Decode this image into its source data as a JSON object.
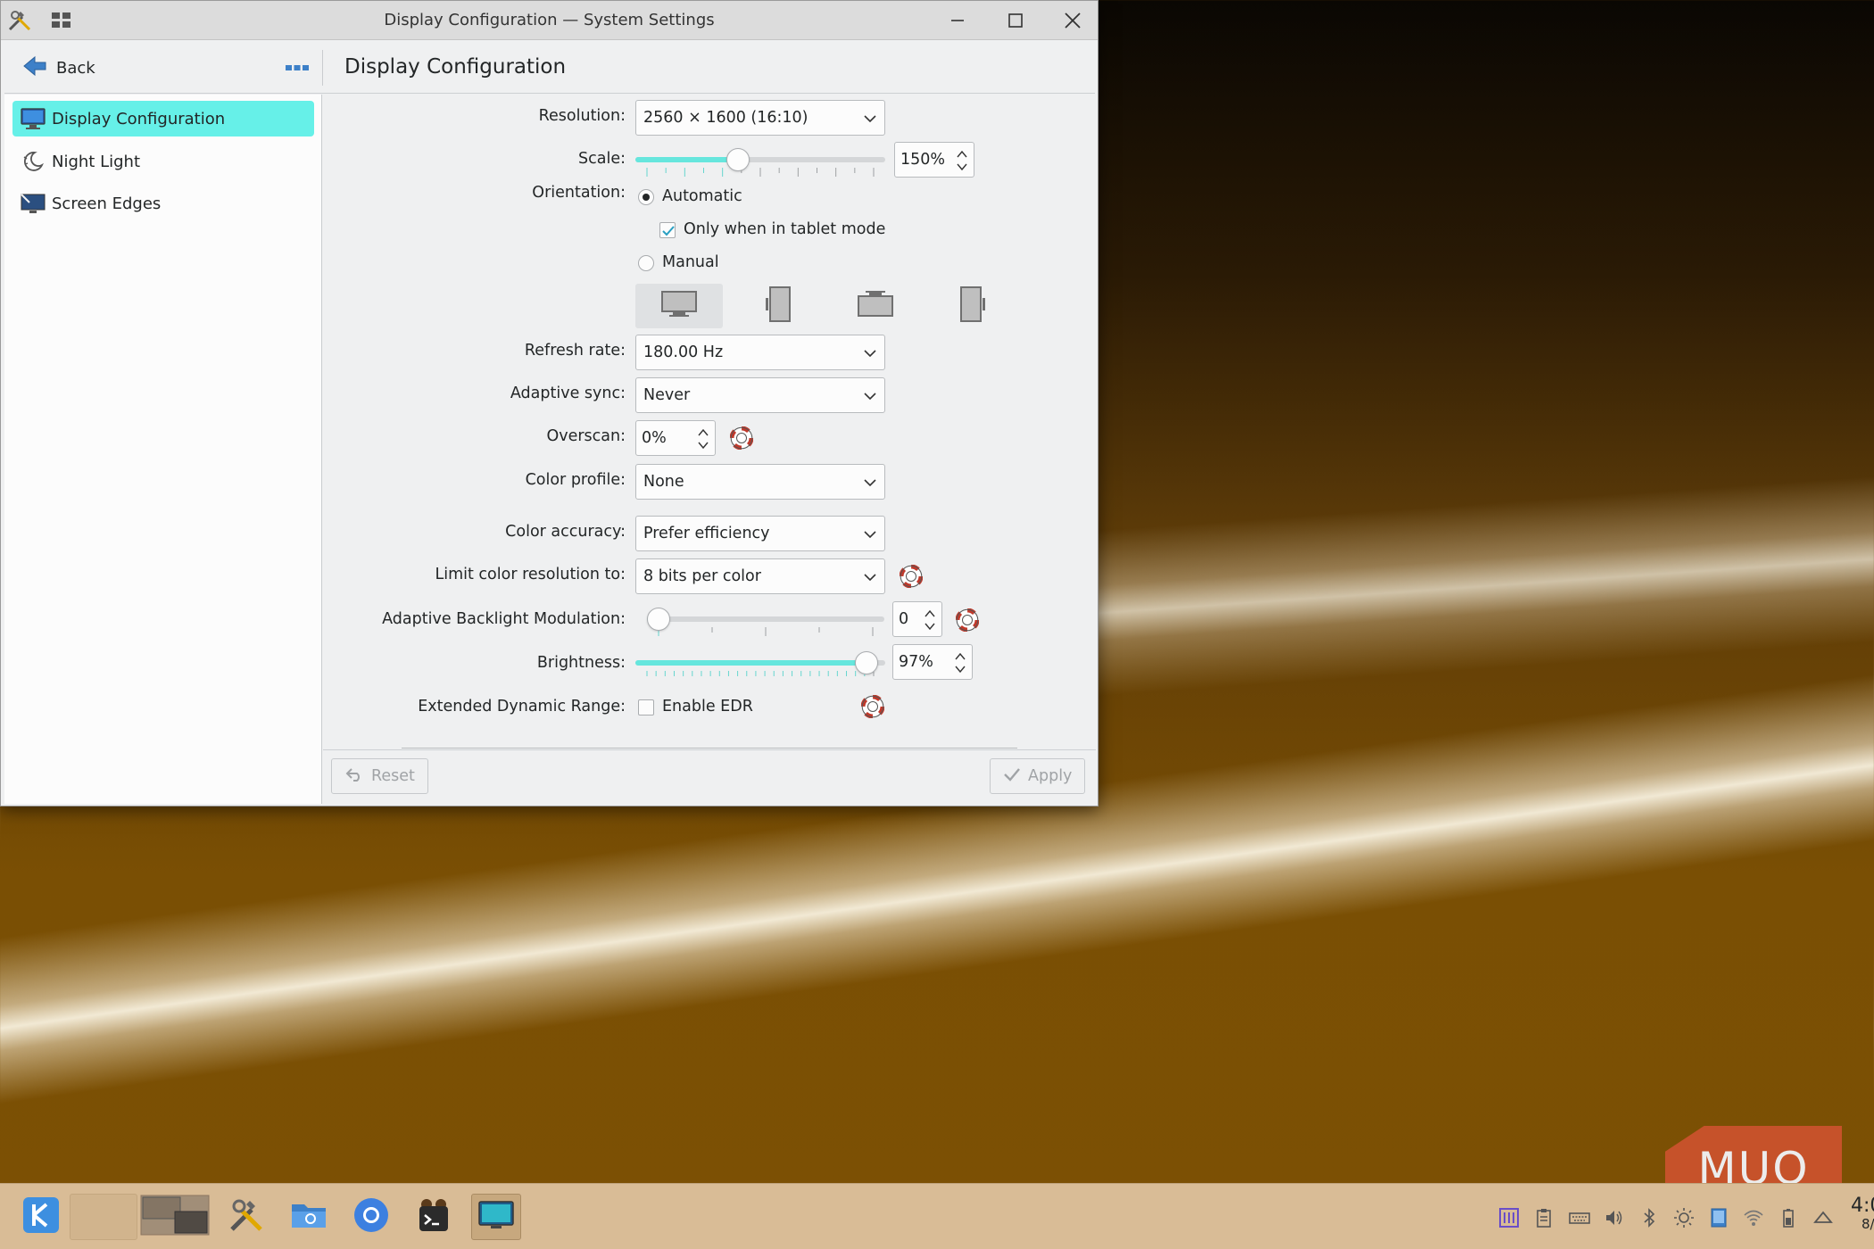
{
  "window": {
    "title": "Display Configuration — System Settings",
    "back_label": "Back",
    "page_title": "Display Configuration"
  },
  "sidebar": {
    "items": [
      {
        "label": "Display Configuration",
        "icon": "monitor-icon",
        "selected": true
      },
      {
        "label": "Night Light",
        "icon": "night-light-icon",
        "selected": false
      },
      {
        "label": "Screen Edges",
        "icon": "screen-edges-icon",
        "selected": false
      }
    ]
  },
  "settings": {
    "resolution": {
      "label": "Resolution:",
      "value": "2560 × 1600 (16:10)"
    },
    "scale": {
      "label": "Scale:",
      "value": "150%",
      "level": 0.4
    },
    "orientation": {
      "label": "Orientation:",
      "automatic": "Automatic",
      "tablet_only": "Only when in tablet mode",
      "manual": "Manual",
      "selected": "Automatic",
      "tablet_only_checked": true
    },
    "refresh_rate": {
      "label": "Refresh rate:",
      "value": "180.00 Hz"
    },
    "adaptive_sync": {
      "label": "Adaptive sync:",
      "value": "Never"
    },
    "overscan": {
      "label": "Overscan:",
      "value": "0%"
    },
    "color_profile": {
      "label": "Color profile:",
      "value": "None"
    },
    "color_accuracy": {
      "label": "Color accuracy:",
      "value": "Prefer efficiency"
    },
    "limit_color_resolution": {
      "label": "Limit color resolution to:",
      "value": "8 bits per color"
    },
    "abm": {
      "label": "Adaptive Backlight Modulation:",
      "value": "0",
      "level": 0
    },
    "brightness": {
      "label": "Brightness:",
      "value": "97%",
      "level": 0.97
    },
    "edr": {
      "label": "Extended Dynamic Range:",
      "checkbox_label": "Enable EDR",
      "checked": false
    }
  },
  "footer": {
    "reset_label": "Reset",
    "apply_label": "Apply"
  },
  "taskbar": {
    "clock_time": "4:0",
    "clock_date": "8/"
  },
  "watermark": "MUO",
  "colors": {
    "accent": "#66f0e8",
    "slider_fill": "#66e6dd"
  }
}
